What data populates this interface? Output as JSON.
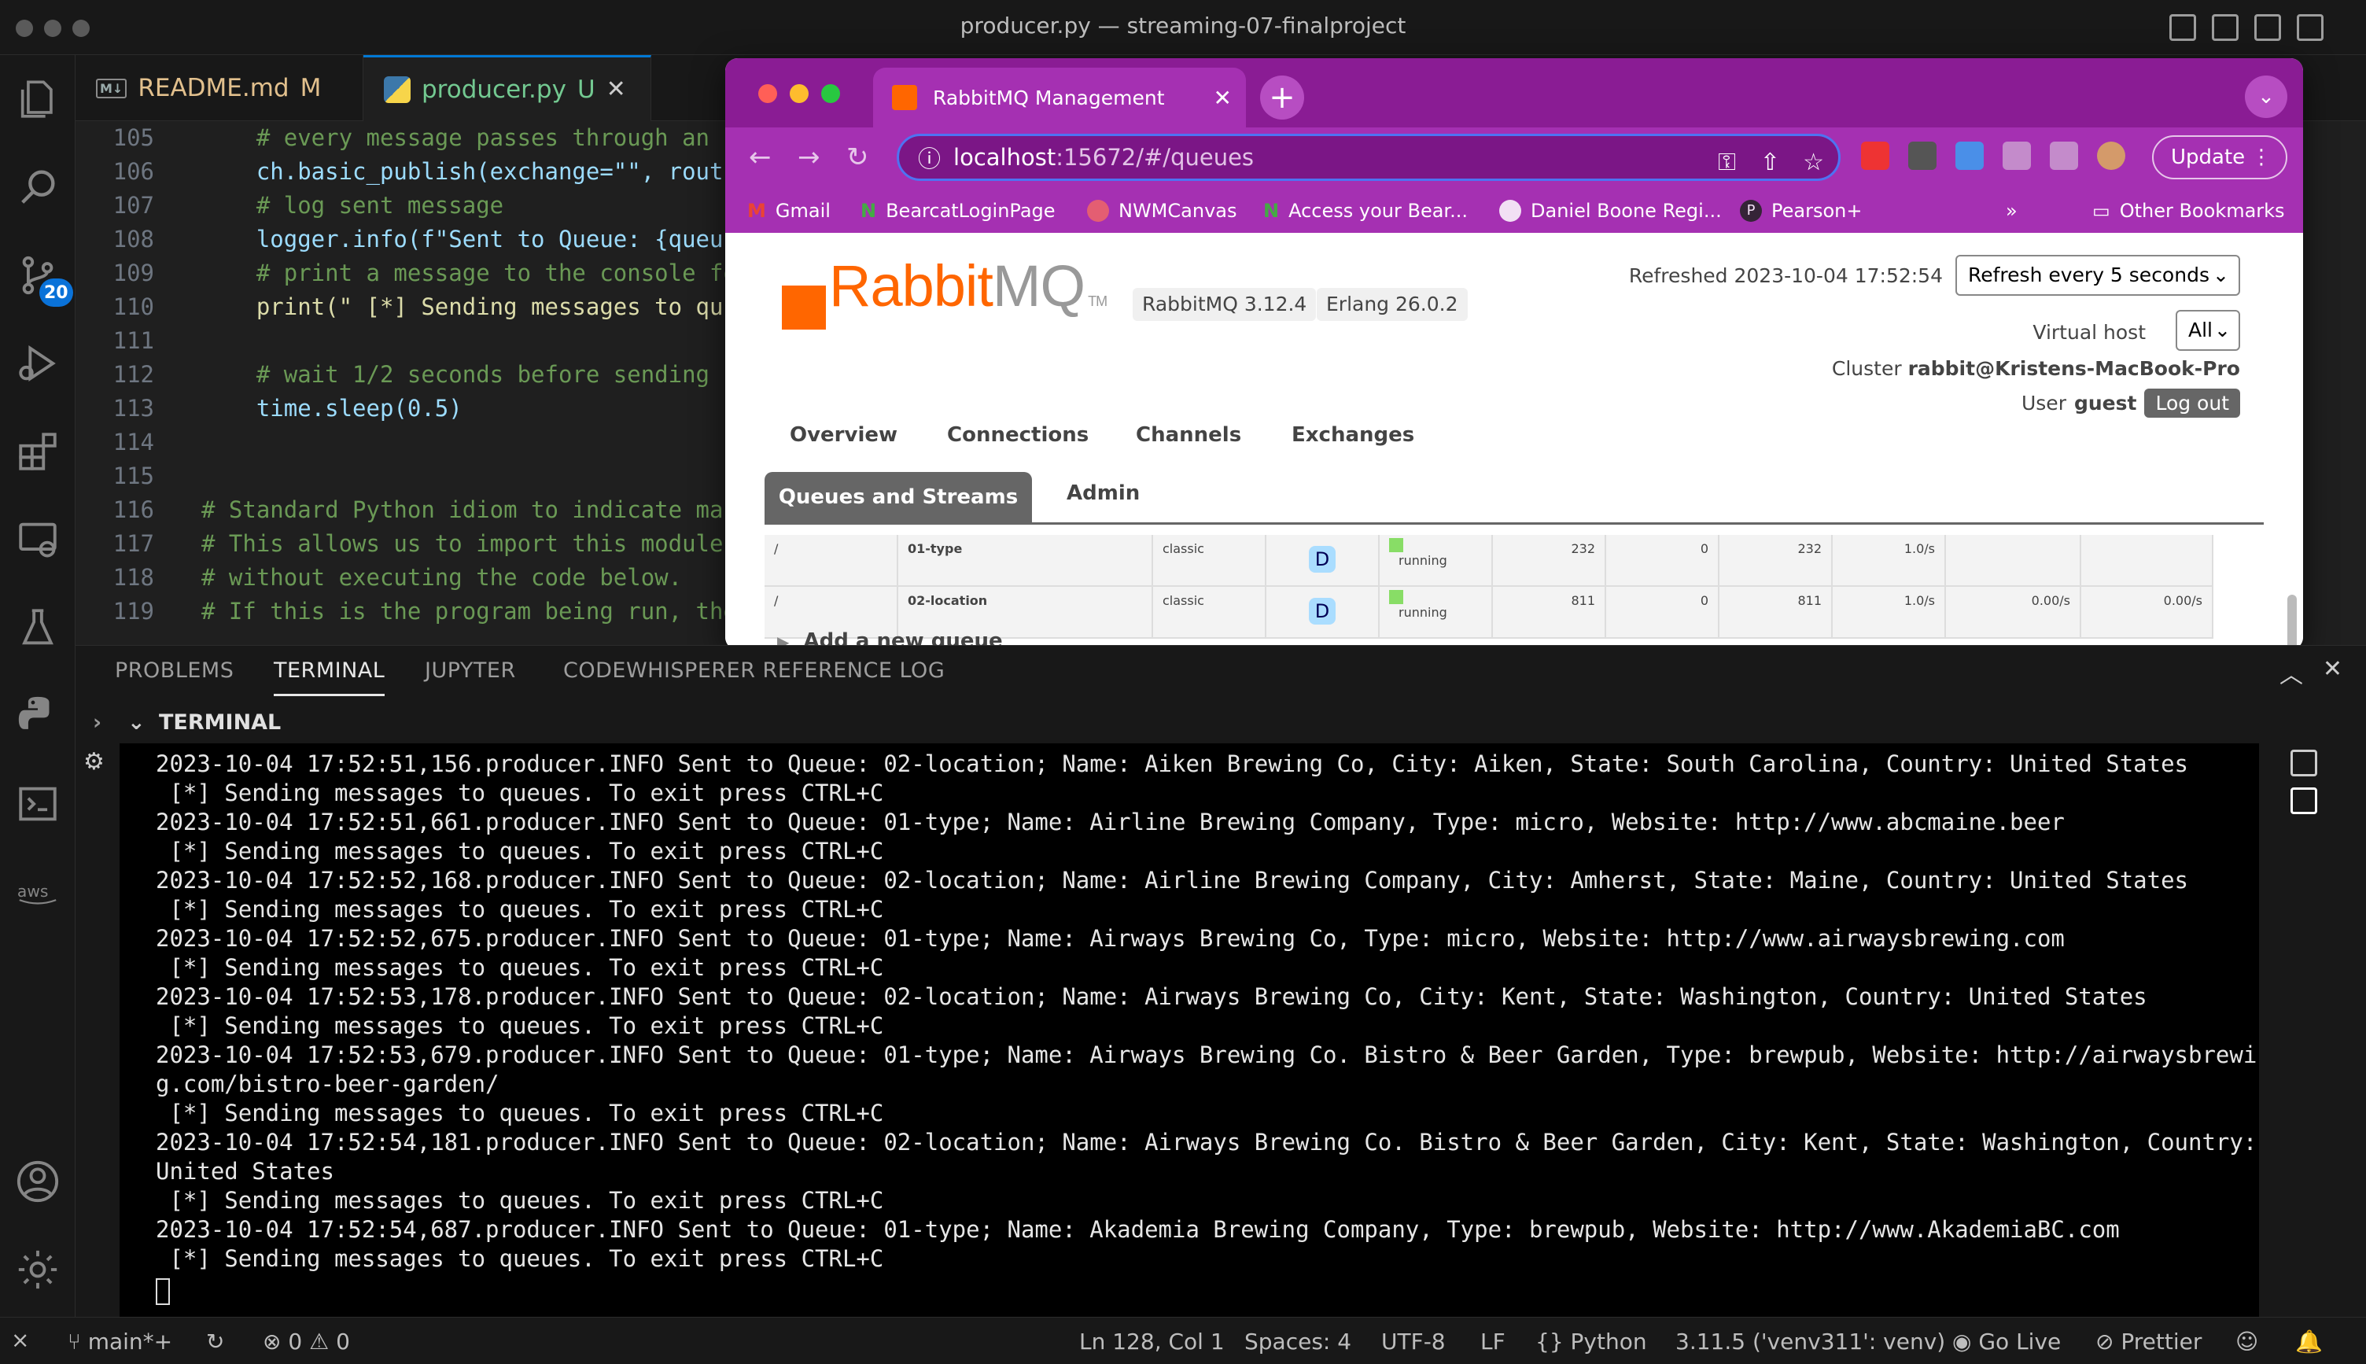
{
  "window": {
    "title": "producer.py — streaming-07-finalproject"
  },
  "activity_bar": {
    "source_control_badge": "20"
  },
  "editor_tabs": [
    {
      "label": "README.md",
      "status": "M"
    },
    {
      "label": "producer.py",
      "status": "U"
    }
  ],
  "editor": {
    "lines": [
      {
        "num": "105",
        "text": "    # every message passes through an "
      },
      {
        "num": "106",
        "text": "    ch.basic_publish(exchange=\"\", routi"
      },
      {
        "num": "107",
        "text": "    # log sent message"
      },
      {
        "num": "108",
        "text": "    logger.info(f\"Sent to Queue: {queu"
      },
      {
        "num": "109",
        "text": "    # print a message to the console fo"
      },
      {
        "num": "110",
        "text": "    print(\" [*] Sending messages to qu"
      },
      {
        "num": "111",
        "text": ""
      },
      {
        "num": "112",
        "text": "    # wait 1/2 seconds before sending "
      },
      {
        "num": "113",
        "text": "    time.sleep(0.5)"
      },
      {
        "num": "114",
        "text": ""
      },
      {
        "num": "115",
        "text": ""
      },
      {
        "num": "116",
        "text": "# Standard Python idiom to indicate ma"
      },
      {
        "num": "117",
        "text": "# This allows us to import this module"
      },
      {
        "num": "118",
        "text": "# without executing the code below."
      },
      {
        "num": "119",
        "text": "# If this is the program being run, the"
      }
    ]
  },
  "browser": {
    "tab_title": "RabbitMQ Management",
    "url_host": "localhost",
    "url_rest": ":15672/#/queues",
    "update_label": "Update",
    "bookmarks": [
      "Gmail",
      "BearcatLoginPage",
      "NWMCanvas",
      "Access your Bear...",
      "Daniel Boone Regi...",
      "Pearson+"
    ],
    "bookmarks_more": "»",
    "other_bookmarks": "Other Bookmarks"
  },
  "rabbitmq": {
    "logo_rabbit": "Rabbit",
    "logo_mq": "MQ",
    "logo_tm": "TM",
    "version": "RabbitMQ 3.12.4",
    "erlang": "Erlang 26.0.2",
    "refreshed": "Refreshed 2023-10-04 17:52:54",
    "refresh_option": "Refresh every 5 seconds",
    "virtual_host_label": "Virtual host",
    "virtual_host_value": "All",
    "cluster_label": "Cluster",
    "cluster_value": "rabbit@Kristens-MacBook-Pro",
    "user_label": "User",
    "user_value": "guest",
    "logout": "Log out",
    "nav": [
      "Overview",
      "Connections",
      "Channels",
      "Exchanges",
      "Queues and Streams",
      "Admin"
    ],
    "queues": [
      {
        "vhost": "/",
        "name": "01-type",
        "type": "classic",
        "feature": "D",
        "state": "running",
        "ready": "232",
        "unacked": "0",
        "total": "232",
        "incoming": "1.0/s",
        "deliver": "",
        "ack": ""
      },
      {
        "vhost": "/",
        "name": "02-location",
        "type": "classic",
        "feature": "D",
        "state": "running",
        "ready": "811",
        "unacked": "0",
        "total": "811",
        "incoming": "1.0/s",
        "deliver": "0.00/s",
        "ack": "0.00/s"
      }
    ],
    "add_queue": "Add a new queue"
  },
  "panel": {
    "tabs": [
      "PROBLEMS",
      "TERMINAL",
      "JUPYTER",
      "CODEWHISPERER REFERENCE LOG"
    ],
    "terminal_header": "TERMINAL",
    "terminal_lines": [
      "2023-10-04 17:52:51,156.producer.INFO Sent to Queue: 02-location; Name: Aiken Brewing Co, City: Aiken, State: South Carolina, Country: United States",
      " [*] Sending messages to queues. To exit press CTRL+C",
      "2023-10-04 17:52:51,661.producer.INFO Sent to Queue: 01-type; Name: Airline Brewing Company, Type: micro, Website: http://www.abcmaine.beer",
      " [*] Sending messages to queues. To exit press CTRL+C",
      "2023-10-04 17:52:52,168.producer.INFO Sent to Queue: 02-location; Name: Airline Brewing Company, City: Amherst, State: Maine, Country: United States",
      " [*] Sending messages to queues. To exit press CTRL+C",
      "2023-10-04 17:52:52,675.producer.INFO Sent to Queue: 01-type; Name: Airways Brewing Co, Type: micro, Website: http://www.airwaysbrewing.com",
      " [*] Sending messages to queues. To exit press CTRL+C",
      "2023-10-04 17:52:53,178.producer.INFO Sent to Queue: 02-location; Name: Airways Brewing Co, City: Kent, State: Washington, Country: United States",
      " [*] Sending messages to queues. To exit press CTRL+C",
      "2023-10-04 17:52:53,679.producer.INFO Sent to Queue: 01-type; Name: Airways Brewing Co. Bistro & Beer Garden, Type: brewpub, Website: http://airwaysbrewin",
      "g.com/bistro-beer-garden/",
      " [*] Sending messages to queues. To exit press CTRL+C",
      "2023-10-04 17:52:54,181.producer.INFO Sent to Queue: 02-location; Name: Airways Brewing Co. Bistro & Beer Garden, City: Kent, State: Washington, Country:",
      "United States",
      " [*] Sending messages to queues. To exit press CTRL+C",
      "2023-10-04 17:52:54,687.producer.INFO Sent to Queue: 01-type; Name: Akademia Brewing Company, Type: brewpub, Website: http://www.AkademiaBC.com",
      " [*] Sending messages to queues. To exit press CTRL+C"
    ]
  },
  "status_bar": {
    "branch": "main*+",
    "errors": "0",
    "warnings": "0",
    "position": "Ln 128, Col 1",
    "spaces": "Spaces: 4",
    "encoding": "UTF-8",
    "eol": "LF",
    "language": "Python",
    "interpreter": "3.11.5 ('venv311': venv)",
    "go_live": "Go Live",
    "prettier": "Prettier"
  },
  "colors": {
    "accent": "#0078d4",
    "browser_theme": "#8a1c94",
    "rabbit_orange": "#ff6600"
  }
}
